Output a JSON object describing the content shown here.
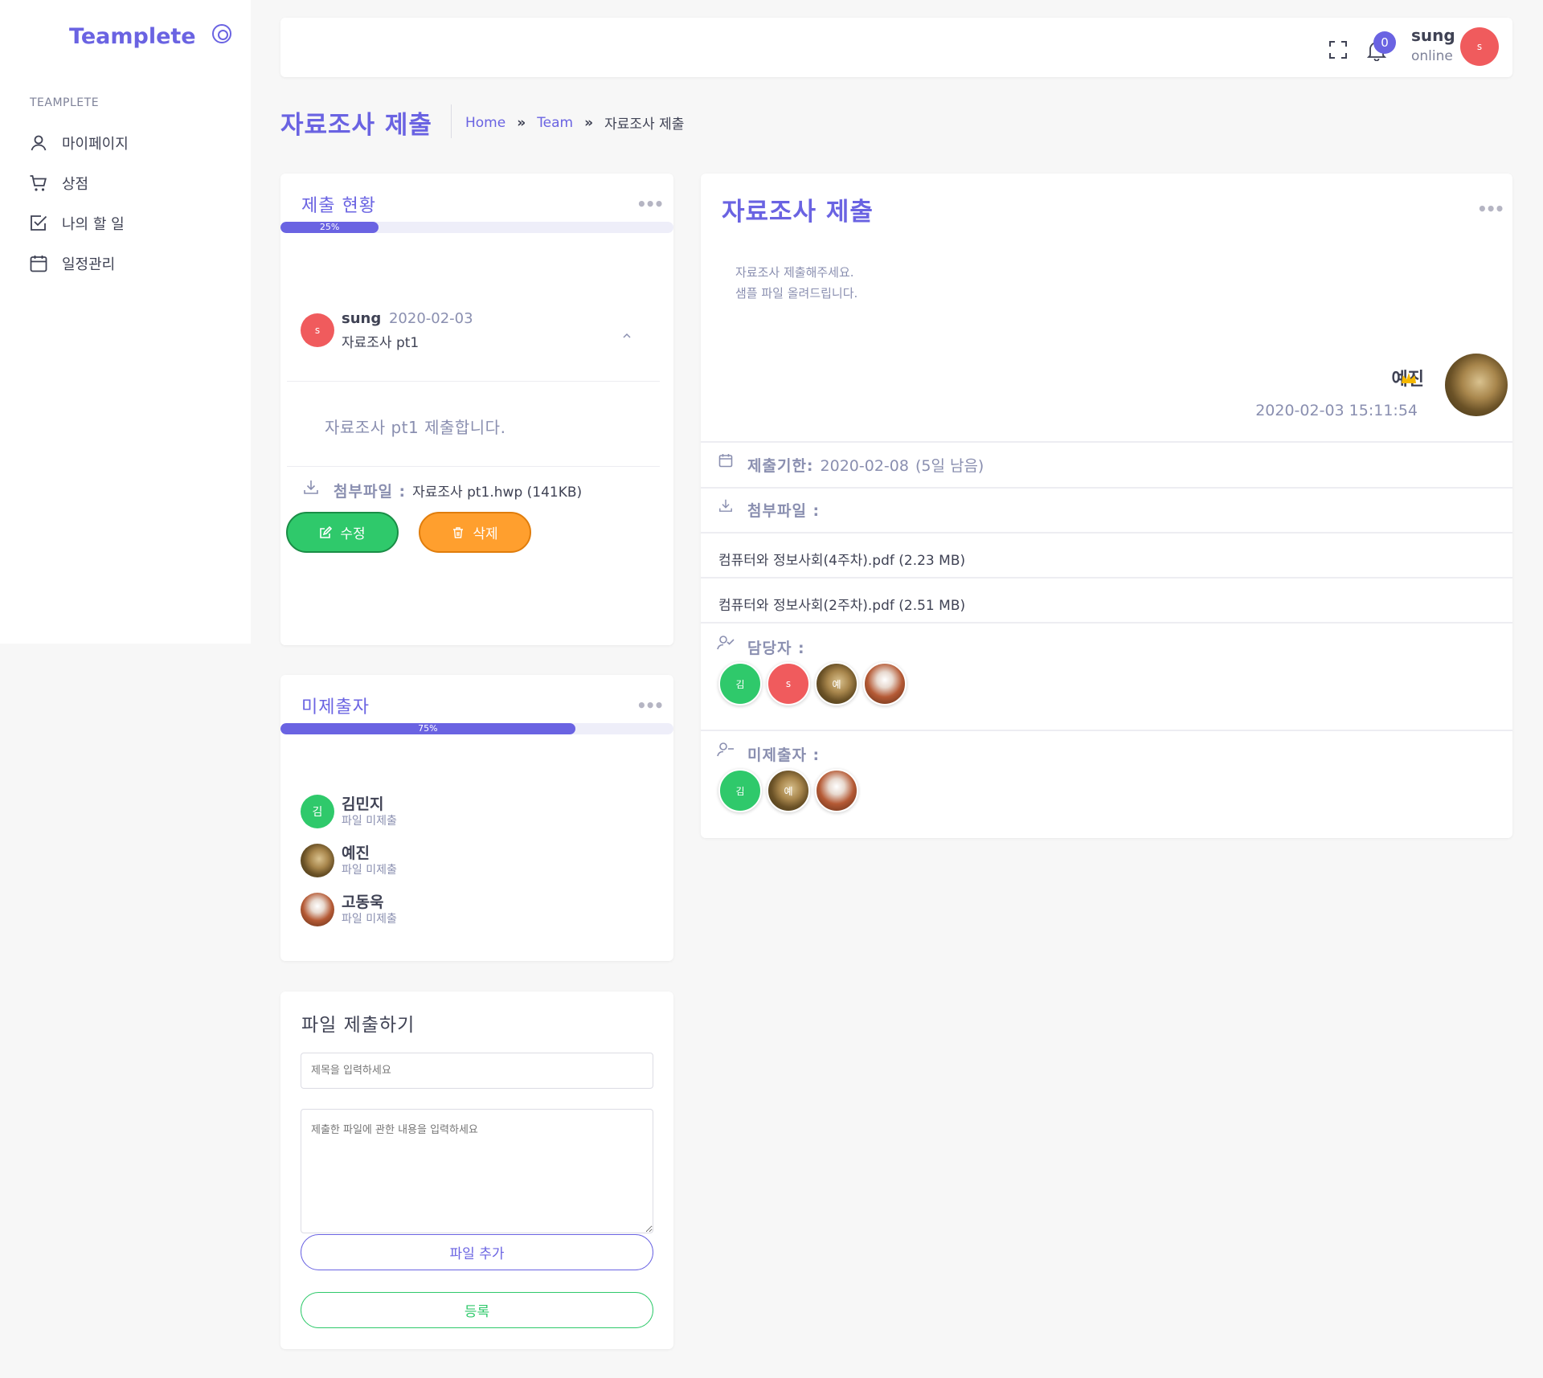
{
  "sidebar": {
    "brand": "Teamplete",
    "section_title": "TEAMPLETE",
    "items": [
      {
        "label": "마이페이지",
        "icon": "user-icon"
      },
      {
        "label": "상점",
        "icon": "cart-icon"
      },
      {
        "label": "나의 할 일",
        "icon": "checkbox-icon"
      },
      {
        "label": "일정관리",
        "icon": "calendar-icon"
      }
    ]
  },
  "topbar": {
    "notification_count": "0",
    "user_name": "sung",
    "user_status": "online",
    "avatar_initial": "s"
  },
  "page": {
    "title": "자료조사 제출",
    "breadcrumb": {
      "home": "Home",
      "team": "Team",
      "current": "자료조사 제출",
      "separator": "»"
    }
  },
  "submission_status": {
    "title": "제출 현황",
    "progress_label": "25%",
    "progress_value": 0.25,
    "entry": {
      "avatar_initial": "s",
      "user": "sung",
      "date": "2020-02-03",
      "subject": "자료조사 pt1",
      "body": "자료조사 pt1 제출합니다.",
      "attachment_label": "첨부파일 :",
      "attachment_file": "자료조사 pt1.hwp (141KB)"
    },
    "edit_label": "수정",
    "delete_label": "삭제"
  },
  "non_submitters": {
    "title": "미제출자",
    "progress_label": "75%",
    "progress_value": 0.75,
    "people": [
      {
        "name": "김민지",
        "status": "파일 미제출",
        "avatar": "green",
        "initial": "김"
      },
      {
        "name": "예진",
        "status": "파일 미제출",
        "avatar": "dog",
        "initial": ""
      },
      {
        "name": "고동욱",
        "status": "파일 미제출",
        "avatar": "cards",
        "initial": ""
      }
    ]
  },
  "upload_form": {
    "title": "파일 제출하기",
    "title_placeholder": "제목을 입력하세요",
    "content_placeholder": "제출한 파일에 관한 내용을 입력하세요",
    "add_file_label": "파일 추가",
    "submit_label": "등록"
  },
  "assignment": {
    "title": "자료조사 제출",
    "description_line1": "자료조사 제출해주세요.",
    "description_line2": "샘플 파일 올려드립니다.",
    "author": "예진",
    "timestamp": "2020-02-03 15:11:54",
    "deadline_label": "제출기한:",
    "deadline_value": "2020-02-08",
    "deadline_remaining": "(5일 남음)",
    "attachment_label": "첨부파일 :",
    "files": [
      "컴퓨터와 정보사회(4주차).pdf (2.23 MB)",
      "컴퓨터와 정보사회(2주차).pdf (2.51 MB)"
    ],
    "assignees_label": "담당자 :",
    "assignees": [
      {
        "avatar": "green",
        "initial": "김"
      },
      {
        "avatar": "red",
        "initial": "s"
      },
      {
        "avatar": "dog",
        "initial": "예"
      },
      {
        "avatar": "cards",
        "initial": ""
      }
    ],
    "non_submitters_label": "미제출자 :",
    "non_submitters": [
      {
        "avatar": "green",
        "initial": "김"
      },
      {
        "avatar": "dog",
        "initial": "예"
      },
      {
        "avatar": "cards",
        "initial": ""
      }
    ]
  },
  "colors": {
    "accent": "#6a63e2",
    "success": "#2fc96b",
    "warning": "#ff9f2e",
    "danger": "#f05b5d"
  }
}
